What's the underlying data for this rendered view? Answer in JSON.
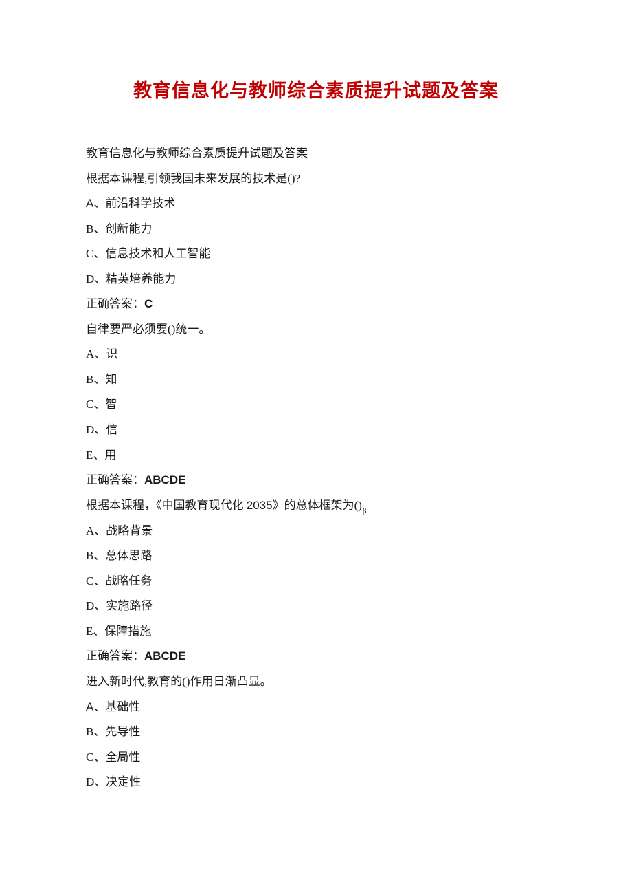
{
  "title": "教育信息化与教师综合素质提升试题及答案",
  "lines": [
    {
      "prefix": "",
      "text": "教育信息化与教师综合素质提升试题及答案",
      "sans": false
    },
    {
      "prefix": "",
      "text": "根据本课程,引领我国未来发展的技术是()?",
      "sans": false
    },
    {
      "prefix": "A",
      "text": "、前沿科学技术",
      "sans": true
    },
    {
      "prefix": "B",
      "text": "、创新能力",
      "sans": false
    },
    {
      "prefix": "C",
      "text": "、信息技术和人工智能",
      "sans": false
    },
    {
      "prefix": "D",
      "text": "、精英培养能力",
      "sans": false
    },
    {
      "prefix": "",
      "text": "正确答案：",
      "bold_suffix": "C",
      "sans": false
    },
    {
      "prefix": "",
      "text": "自律要严必须要()统一。",
      "sans": false
    },
    {
      "prefix": "A",
      "text": "、识",
      "sans": false
    },
    {
      "prefix": "B",
      "text": "、知",
      "sans": false
    },
    {
      "prefix": "C",
      "text": "、智",
      "sans": false
    },
    {
      "prefix": "D",
      "text": "、信",
      "sans": false
    },
    {
      "prefix": "E",
      "text": "、用",
      "sans": false
    },
    {
      "prefix": "",
      "text": "正确答案：",
      "bold_suffix": "ABCDE",
      "sans": false
    },
    {
      "prefix": "",
      "text": "根据本课程，《中国教育现代化 ",
      "mid": "2035",
      "text2": "》的总体框架为()",
      "sub": "β",
      "sans": false
    },
    {
      "prefix": "A",
      "text": "、战略背景",
      "sans": false
    },
    {
      "prefix": "B",
      "text": "、总体思路",
      "sans": false
    },
    {
      "prefix": "C",
      "text": "、战略任务",
      "sans": false
    },
    {
      "prefix": "D",
      "text": "、实施路径",
      "sans": false
    },
    {
      "prefix": "E",
      "text": "、保障措施",
      "sans": false
    },
    {
      "prefix": "",
      "text": "正确答案：",
      "bold_suffix": "ABCDE",
      "sans": false
    },
    {
      "prefix": "",
      "text": "进入新时代,教育的()作用日渐凸显。",
      "sans": false
    },
    {
      "prefix": "A",
      "text": "、基础性",
      "sans": true
    },
    {
      "prefix": "B",
      "text": "、先导性",
      "sans": false
    },
    {
      "prefix": "C",
      "text": "、全局性",
      "sans": false
    },
    {
      "prefix": "D",
      "text": "、决定性",
      "sans": false
    }
  ]
}
